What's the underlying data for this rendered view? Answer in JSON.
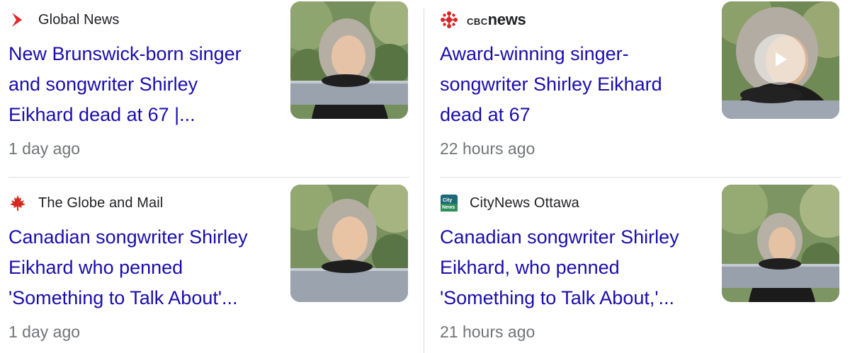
{
  "cards": [
    {
      "source": "Global News",
      "headline": [
        "New Brunswick-born singer",
        "and songwriter Shirley",
        "Eikhard dead at 67 |..."
      ],
      "time": "1 day ago",
      "logo": "global-news-logo-icon"
    },
    {
      "source": "CBC News",
      "source_wordmark": {
        "cbc": "CBC",
        "news": "news"
      },
      "headline": [
        "Award-winning singer-",
        "songwriter Shirley Eikhard",
        "dead at 67"
      ],
      "time": "22 hours ago",
      "logo": "cbc-gem-logo-icon",
      "has_video": true
    },
    {
      "source": "The Globe and Mail",
      "headline": [
        "Canadian songwriter Shirley",
        "Eikhard who penned",
        "'Something to Talk About'..."
      ],
      "time": "1 day ago",
      "logo": "maple-leaf-logo-icon"
    },
    {
      "source": "CityNews Ottawa",
      "headline": [
        "Canadian songwriter Shirley",
        "Eikhard, who penned",
        "'Something to Talk About,'..."
      ],
      "time": "21 hours ago",
      "logo": "citynews-logo-icon",
      "logo_text": {
        "line1": "City",
        "line2": "News"
      }
    }
  ],
  "colors": {
    "headline": "#1a0dab",
    "meta": "#70757a",
    "divider": "#dadce0",
    "global_red": "#e4252c",
    "cbc_red": "#d8232a",
    "globe_red": "#d52b1e",
    "citynews_teal": "#1c6a77"
  }
}
